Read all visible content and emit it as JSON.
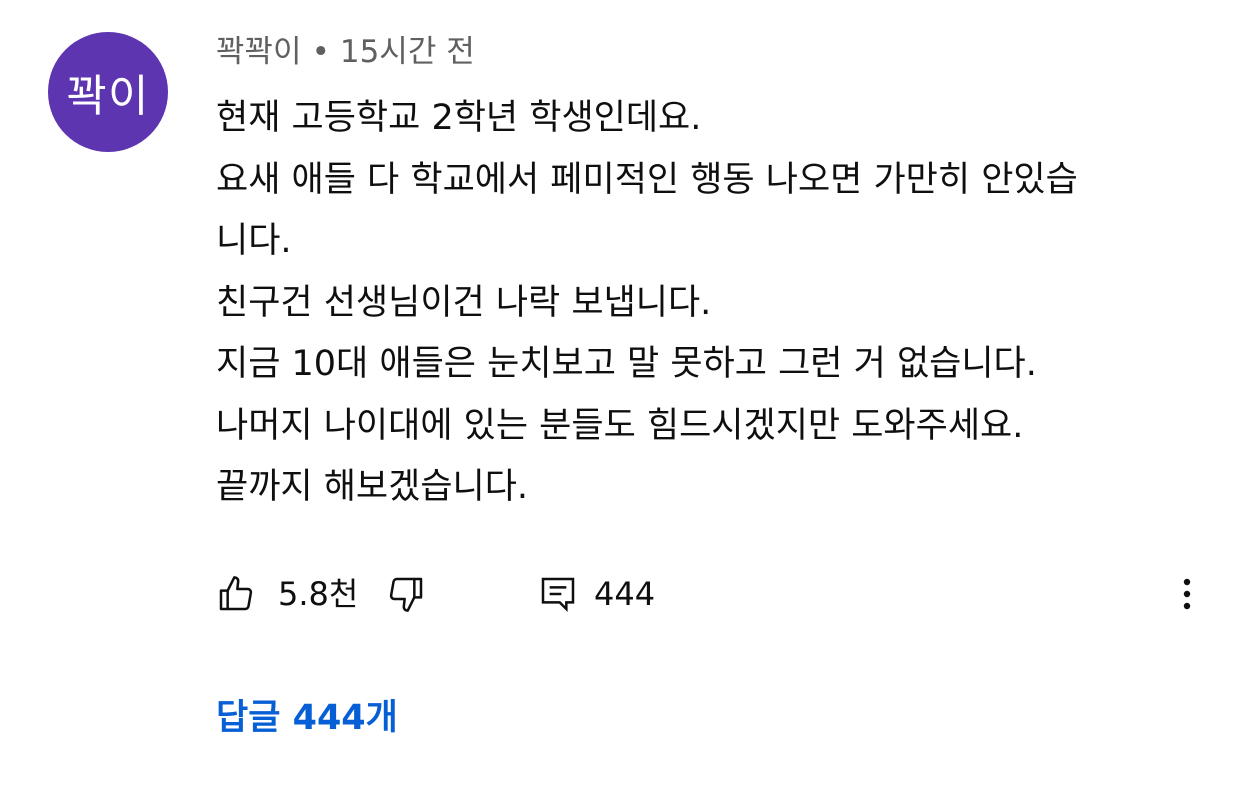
{
  "comment": {
    "avatar_text": "꽉이",
    "avatar_color": "#5e35b1",
    "author": "꽉꽉이",
    "separator": "•",
    "time": "15시간 전",
    "lines": [
      "현재 고등학교 2학년 학생인데요.",
      "요새 애들 다 학교에서 페미적인 행동 나오면 가만히 안있습",
      "니다.",
      "친구건 선생님이건 나락 보냅니다.",
      "지금 10대 애들은 눈치보고 말 못하고 그런 거 없습니다.",
      "나머지 나이대에 있는 분들도 힘드시겠지만 도와주세요.",
      "끝까지 해보겠습니다."
    ]
  },
  "actions": {
    "like_icon": "thumbs-up-icon",
    "like_count": "5.8천",
    "dislike_icon": "thumbs-down-icon",
    "reply_icon": "comment-icon",
    "reply_count": "444",
    "more_icon": "more-vert-icon"
  },
  "replies": {
    "label": "답글 444개",
    "color": "#065fd4"
  }
}
